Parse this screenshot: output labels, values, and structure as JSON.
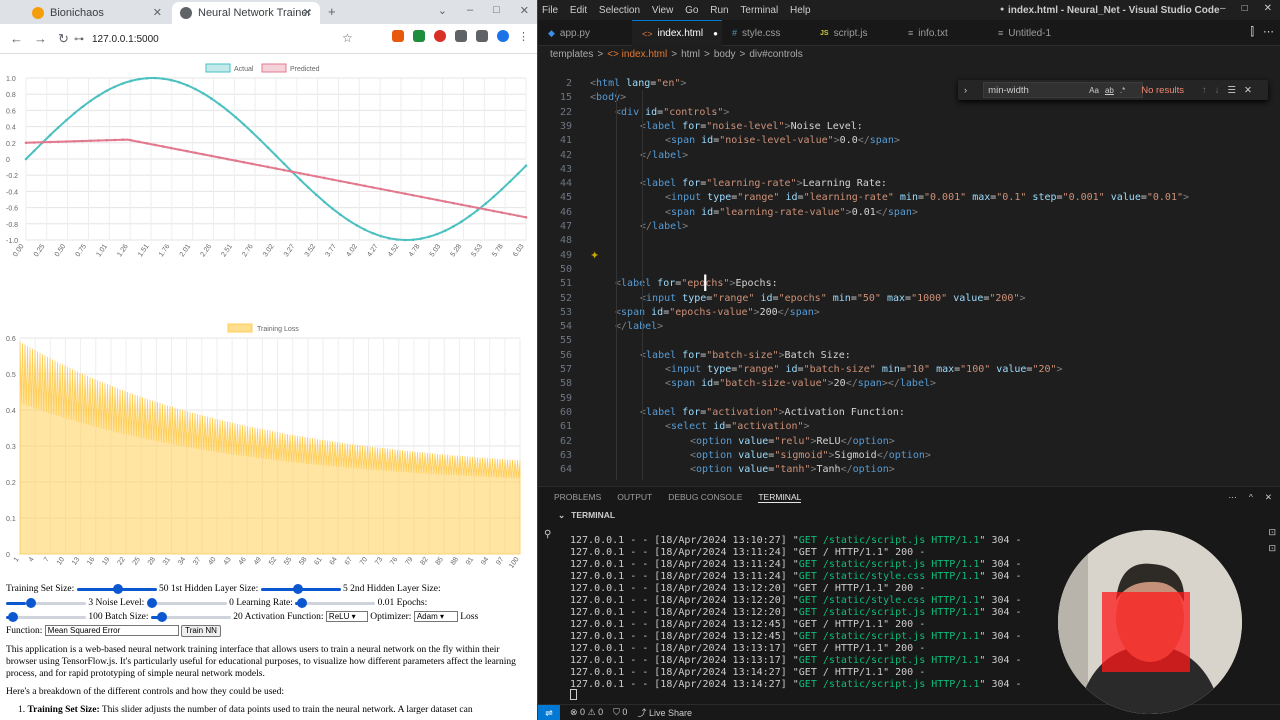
{
  "browser": {
    "tabs": [
      {
        "title": "Bionichaos",
        "active": false
      },
      {
        "title": "Neural Network Trainer",
        "active": true
      }
    ],
    "new_tab": "+",
    "url": "127.0.0.1:5000",
    "win": [
      "⌄",
      "–",
      "□",
      "✕"
    ]
  },
  "chart_data": [
    {
      "type": "line",
      "title": "",
      "legend": [
        "Actual",
        "Predicted"
      ],
      "colors": [
        "#4bc0c0",
        "#e2788e"
      ],
      "x_ticks": [
        "0.00",
        "0.25",
        "0.50",
        "0.75",
        "1.01",
        "1.26",
        "1.51",
        "1.76",
        "2.01",
        "2.26",
        "2.51",
        "2.76",
        "3.02",
        "3.27",
        "3.52",
        "3.77",
        "4.02",
        "4.27",
        "4.52",
        "4.78",
        "5.03",
        "5.28",
        "5.53",
        "5.78",
        "6.03"
      ],
      "y_ticks": [
        "1.0",
        "0.8",
        "0.6",
        "0.4",
        "0.2",
        "0",
        "-0.2",
        "-0.4",
        "-0.6",
        "-0.8",
        "-1.0"
      ],
      "ylim": [
        -1,
        1
      ],
      "series": [
        {
          "name": "Actual",
          "function": "sin(x)",
          "xrange": [
            0,
            6.2
          ]
        },
        {
          "name": "Predicted",
          "points": [
            [
              0,
              0.2
            ],
            [
              1.26,
              0.24
            ],
            [
              6.2,
              -0.72
            ]
          ]
        }
      ]
    },
    {
      "type": "area",
      "legend": [
        "Training Loss"
      ],
      "color": "#ffcd56",
      "x_ticks": [
        "1",
        "4",
        "7",
        "10",
        "13",
        "16",
        "19",
        "22",
        "25",
        "28",
        "31",
        "34",
        "37",
        "40",
        "43",
        "46",
        "49",
        "52",
        "55",
        "58",
        "61",
        "64",
        "67",
        "70",
        "73",
        "76",
        "79",
        "82",
        "85",
        "88",
        "91",
        "94",
        "97",
        "100"
      ],
      "y_ticks": [
        "0.6",
        "0.5",
        "0.4",
        "0.3",
        "0.2",
        "0.1",
        "0"
      ],
      "ylim": [
        0,
        0.6
      ],
      "series": [
        {
          "name": "Training Loss",
          "start_max": 0.59,
          "start_min": 0.42,
          "end_max": 0.26,
          "end_min": 0.21
        }
      ]
    }
  ],
  "controls": {
    "training_set_label": "Training Set Size:",
    "training_set_value": "50",
    "hidden1_label": "1st Hidden Layer Size:",
    "hidden1_value": "5",
    "hidden2_label": "2nd Hidden Layer Size:",
    "hidden2_value": "3",
    "noise_label": "Noise Level:",
    "noise_value": "0",
    "lr_label": "Learning Rate:",
    "lr_value": "0.01",
    "epochs_label": "Epochs:",
    "epochs_value": "100",
    "batch_label": "Batch Size:",
    "batch_value": "20",
    "activation_label": "Activation Function:",
    "activation_value": "ReLU",
    "optimizer_label": "Optimizer:",
    "optimizer_value": "Adam",
    "loss_label": "Loss",
    "loss_label2": "Function:",
    "loss_value": "Mean Squared Error",
    "train_button": "Train NN"
  },
  "description": {
    "p1": "This application is a web-based neural network training interface that allows users to train a neural network on the fly within their browser using TensorFlow.js. It's particularly useful for educational purposes, to visualize how different parameters affect the learning process, and for rapid prototyping of simple neural network models.",
    "p2": "Here's a breakdown of the different controls and how they could be used:",
    "li1_num": "1.",
    "li1_bold": "Training Set Size:",
    "li1_text": " This slider adjusts the number of data points used to train the neural network. A larger dataset can"
  },
  "vscode": {
    "menu": [
      "File",
      "Edit",
      "Selection",
      "View",
      "Go",
      "Run",
      "Terminal",
      "Help"
    ],
    "window_title": "index.html - Neural_Net - Visual Studio Code",
    "tabs": [
      {
        "label": "app.py",
        "icon": "◆"
      },
      {
        "label": "index.html",
        "icon": "<>",
        "active": true,
        "dirty": "●"
      },
      {
        "label": "style.css",
        "icon": "#"
      },
      {
        "label": "script.js",
        "icon": "JS"
      },
      {
        "label": "info.txt",
        "icon": "≡"
      },
      {
        "label": "Untitled-1",
        "icon": "≡"
      }
    ],
    "breadcrumbs": [
      "templates",
      ">",
      "<> index.html",
      ">",
      "html",
      ">",
      "body",
      ">",
      "div#controls"
    ],
    "find": {
      "query": "min-width",
      "match_case": "Aa",
      "whole": "ab",
      "regex": ".*",
      "result": "No results"
    },
    "lines": [
      {
        "n": "2",
        "html": "<span class='pu'>&lt;</span><span class='tg'>html</span> <span class='at'>lang</span><span class='tx'>=</span><span class='st'>\"en\"</span><span class='pu'>&gt;</span>",
        "indent": 0
      },
      {
        "n": "15",
        "html": "<span class='pu'>&lt;</span><span class='tg'>body</span><span class='pu'>&gt;</span>",
        "indent": 0
      },
      {
        "n": "22",
        "html": "<span class='pu'>&lt;</span><span class='tg'>div</span> <span class='at'>id</span><span class='tx'>=</span><span class='st'>\"controls\"</span><span class='pu'>&gt;</span>",
        "indent": 1
      },
      {
        "n": "39",
        "html": "<span class='pu'>&lt;</span><span class='tg'>label</span> <span class='at'>for</span><span class='tx'>=</span><span class='st'>\"noise-level\"</span><span class='pu'>&gt;</span><span class='tx'>Noise Level:</span>",
        "indent": 2
      },
      {
        "n": "41",
        "html": "<span class='pu'>&lt;</span><span class='tg'>span</span> <span class='at'>id</span><span class='tx'>=</span><span class='st'>\"noise-level-value\"</span><span class='pu'>&gt;</span><span class='tx'>0.0</span><span class='pu'>&lt;/</span><span class='tg'>span</span><span class='pu'>&gt;</span>",
        "indent": 3
      },
      {
        "n": "42",
        "html": "<span class='pu'>&lt;/</span><span class='tg'>label</span><span class='pu'>&gt;</span>",
        "indent": 2
      },
      {
        "n": "43",
        "html": "",
        "indent": 0
      },
      {
        "n": "44",
        "html": "<span class='pu'>&lt;</span><span class='tg'>label</span> <span class='at'>for</span><span class='tx'>=</span><span class='st'>\"learning-rate\"</span><span class='pu'>&gt;</span><span class='tx'>Learning Rate:</span>",
        "indent": 2
      },
      {
        "n": "45",
        "html": "<span class='pu'>&lt;</span><span class='tg'>input</span> <span class='at'>type</span><span class='tx'>=</span><span class='st'>\"range\"</span> <span class='at'>id</span><span class='tx'>=</span><span class='st'>\"learning-rate\"</span> <span class='at'>min</span><span class='tx'>=</span><span class='st'>\"0.001\"</span> <span class='at'>max</span><span class='tx'>=</span><span class='st'>\"0.1\"</span> <span class='at'>step</span><span class='tx'>=</span><span class='st'>\"0.001\"</span> <span class='at'>value</span><span class='tx'>=</span><span class='st'>\"0.01\"</span><span class='pu'>&gt;</span>",
        "indent": 3
      },
      {
        "n": "46",
        "html": "<span class='pu'>&lt;</span><span class='tg'>span</span> <span class='at'>id</span><span class='tx'>=</span><span class='st'>\"learning-rate-value\"</span><span class='pu'>&gt;</span><span class='tx'>0.01</span><span class='pu'>&lt;/</span><span class='tg'>span</span><span class='pu'>&gt;</span>",
        "indent": 3
      },
      {
        "n": "47",
        "html": "<span class='pu'>&lt;/</span><span class='tg'>label</span><span class='pu'>&gt;</span>",
        "indent": 2
      },
      {
        "n": "48",
        "html": "",
        "indent": 0
      },
      {
        "n": "49",
        "html": "",
        "indent": 0
      },
      {
        "n": "50",
        "html": "",
        "indent": 0
      },
      {
        "n": "51",
        "html": "<span class='pu'>&lt;</span><span class='tg'>label</span> <span class='at'>for</span><span class='tx'>=</span><span class='st'>\"epochs\"</span><span class='pu'>&gt;</span><span class='tx'>Epochs:</span>",
        "indent": 1
      },
      {
        "n": "52",
        "html": "<span class='pu'>&lt;</span><span class='tg'>input</span> <span class='at'>type</span><span class='tx'>=</span><span class='st'>\"range\"</span> <span class='at'>id</span><span class='tx'>=</span><span class='st'>\"epochs\"</span> <span class='at'>min</span><span class='tx'>=</span><span class='st'>\"50\"</span> <span class='at'>max</span><span class='tx'>=</span><span class='st'>\"1000\"</span> <span class='at'>value</span><span class='tx'>=</span><span class='st'>\"200\"</span><span class='pu'>&gt;</span>",
        "indent": 2
      },
      {
        "n": "53",
        "html": "<span class='pu'>&lt;</span><span class='tg'>span</span> <span class='at'>id</span><span class='tx'>=</span><span class='st'>\"epochs-value\"</span><span class='pu'>&gt;</span><span class='tx'>200</span><span class='pu'>&lt;/</span><span class='tg'>span</span><span class='pu'>&gt;</span>",
        "indent": 1
      },
      {
        "n": "54",
        "html": "<span class='pu'>&lt;/</span><span class='tg'>label</span><span class='pu'>&gt;</span>",
        "indent": 1
      },
      {
        "n": "55",
        "html": "",
        "indent": 0
      },
      {
        "n": "56",
        "html": "<span class='pu'>&lt;</span><span class='tg'>label</span> <span class='at'>for</span><span class='tx'>=</span><span class='st'>\"batch-size\"</span><span class='pu'>&gt;</span><span class='tx'>Batch Size:</span>",
        "indent": 2
      },
      {
        "n": "57",
        "html": "<span class='pu'>&lt;</span><span class='tg'>input</span> <span class='at'>type</span><span class='tx'>=</span><span class='st'>\"range\"</span> <span class='at'>id</span><span class='tx'>=</span><span class='st'>\"batch-size\"</span> <span class='at'>min</span><span class='tx'>=</span><span class='st'>\"10\"</span> <span class='at'>max</span><span class='tx'>=</span><span class='st'>\"100\"</span> <span class='at'>value</span><span class='tx'>=</span><span class='st'>\"20\"</span><span class='pu'>&gt;</span>",
        "indent": 3
      },
      {
        "n": "58",
        "html": "<span class='pu'>&lt;</span><span class='tg'>span</span> <span class='at'>id</span><span class='tx'>=</span><span class='st'>\"batch-size-value\"</span><span class='pu'>&gt;</span><span class='tx'>20</span><span class='pu'>&lt;/</span><span class='tg'>span</span><span class='pu'>&gt;&lt;/</span><span class='tg'>label</span><span class='pu'>&gt;</span>",
        "indent": 3
      },
      {
        "n": "59",
        "html": "",
        "indent": 0
      },
      {
        "n": "60",
        "html": "<span class='pu'>&lt;</span><span class='tg'>label</span> <span class='at'>for</span><span class='tx'>=</span><span class='st'>\"activation\"</span><span class='pu'>&gt;</span><span class='tx'>Activation Function:</span>",
        "indent": 2
      },
      {
        "n": "61",
        "html": "<span class='pu'>&lt;</span><span class='tg'>select</span> <span class='at'>id</span><span class='tx'>=</span><span class='st'>\"activation\"</span><span class='pu'>&gt;</span>",
        "indent": 3
      },
      {
        "n": "62",
        "html": "<span class='pu'>&lt;</span><span class='tg'>option</span> <span class='at'>value</span><span class='tx'>=</span><span class='st'>\"relu\"</span><span class='pu'>&gt;</span><span class='tx'>ReLU</span><span class='pu'>&lt;/</span><span class='tg'>option</span><span class='pu'>&gt;</span>",
        "indent": 4
      },
      {
        "n": "63",
        "html": "<span class='pu'>&lt;</span><span class='tg'>option</span> <span class='at'>value</span><span class='tx'>=</span><span class='st'>\"sigmoid\"</span><span class='pu'>&gt;</span><span class='tx'>Sigmoid</span><span class='pu'>&lt;/</span><span class='tg'>option</span><span class='pu'>&gt;</span>",
        "indent": 4
      },
      {
        "n": "64",
        "html": "<span class='pu'>&lt;</span><span class='tg'>option</span> <span class='at'>value</span><span class='tx'>=</span><span class='st'>\"tanh\"</span><span class='pu'>&gt;</span><span class='tx'>Tanh</span><span class='pu'>&lt;/</span><span class='tg'>option</span><span class='pu'>&gt;</span>",
        "indent": 4
      }
    ],
    "panel_tabs": [
      "PROBLEMS",
      "OUTPUT",
      "DEBUG CONSOLE",
      "TERMINAL"
    ],
    "terminal_title": "TERMINAL",
    "terminal_lines": [
      {
        "pre": "127.0.0.1 - - [18/Apr/2024 13:10:27] \"",
        "req": "GET /static/script.js HTTP/1.1",
        "post": "\" 304 -",
        "code": "304"
      },
      {
        "pre": "127.0.0.1 - - [18/Apr/2024 13:11:24] \"",
        "req": "GET / HTTP/1.1",
        "post": "\" 200 -",
        "code": "200"
      },
      {
        "pre": "127.0.0.1 - - [18/Apr/2024 13:11:24] \"",
        "req": "GET /static/script.js HTTP/1.1",
        "post": "\" 304 -",
        "code": "304"
      },
      {
        "pre": "127.0.0.1 - - [18/Apr/2024 13:11:24] \"",
        "req": "GET /static/style.css HTTP/1.1",
        "post": "\" 304 -",
        "code": "304"
      },
      {
        "pre": "127.0.0.1 - - [18/Apr/2024 13:12:20] \"",
        "req": "GET / HTTP/1.1",
        "post": "\" 200 -",
        "code": "200"
      },
      {
        "pre": "127.0.0.1 - - [18/Apr/2024 13:12:20] \"",
        "req": "GET /static/style.css HTTP/1.1",
        "post": "\" 304 -",
        "code": "304"
      },
      {
        "pre": "127.0.0.1 - - [18/Apr/2024 13:12:20] \"",
        "req": "GET /static/script.js HTTP/1.1",
        "post": "\" 304 -",
        "code": "304"
      },
      {
        "pre": "127.0.0.1 - - [18/Apr/2024 13:12:45] \"",
        "req": "GET / HTTP/1.1",
        "post": "\" 200 -",
        "code": "200"
      },
      {
        "pre": "127.0.0.1 - - [18/Apr/2024 13:12:45] \"",
        "req": "GET /static/script.js HTTP/1.1",
        "post": "\" 304 -",
        "code": "304"
      },
      {
        "pre": "127.0.0.1 - - [18/Apr/2024 13:13:17] \"",
        "req": "GET / HTTP/1.1",
        "post": "\" 200 -",
        "code": "200"
      },
      {
        "pre": "127.0.0.1 - - [18/Apr/2024 13:13:17] \"",
        "req": "GET /static/script.js HTTP/1.1",
        "post": "\" 304 -",
        "code": "304"
      },
      {
        "pre": "127.0.0.1 - - [18/Apr/2024 13:14:27] \"",
        "req": "GET / HTTP/1.1",
        "post": "\" 200 -",
        "code": "200"
      },
      {
        "pre": "127.0.0.1 - - [18/Apr/2024 13:14:27] \"",
        "req": "GET /static/script.js HTTP/1.1",
        "post": "\" 304 -",
        "code": "304"
      }
    ],
    "status": {
      "errors": "0",
      "warnings": "0",
      "ports": "0",
      "live": "Live Share"
    }
  }
}
